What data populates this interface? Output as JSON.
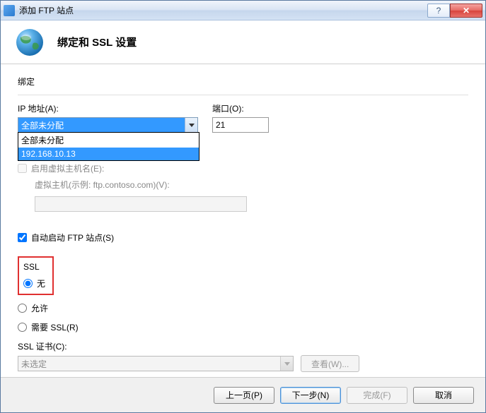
{
  "titlebar": {
    "title": "添加 FTP 站点",
    "help_symbol": "?",
    "close_symbol": "✕"
  },
  "header": {
    "title": "绑定和 SSL 设置"
  },
  "binding": {
    "group_label": "绑定",
    "ip_label": "IP 地址(A):",
    "ip_value": "全部未分配",
    "port_label": "端口(O):",
    "port_value": "21",
    "dropdown_options": [
      "全部未分配",
      "192.168.10.13"
    ],
    "highlighted_index": 1
  },
  "virtual_host": {
    "enable_label": "启用虚拟主机名(E):",
    "vhost_label": "虚拟主机(示例: ftp.contoso.com)(V):"
  },
  "auto_start": {
    "label": "自动启动 FTP 站点(S)"
  },
  "ssl": {
    "title": "SSL",
    "none_label": "无",
    "allow_label": "允许",
    "require_label": "需要 SSL(R)",
    "cert_label": "SSL 证书(C):",
    "cert_value": "未选定",
    "view_btn": "查看(W)..."
  },
  "footer": {
    "prev": "上一页(P)",
    "next": "下一步(N)",
    "finish": "完成(F)",
    "cancel": "取消"
  }
}
